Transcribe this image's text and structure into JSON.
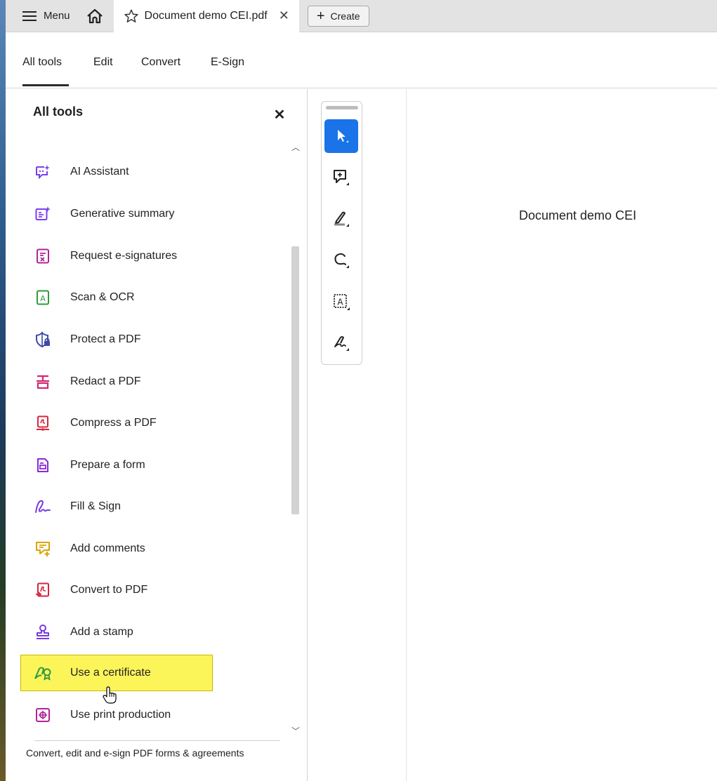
{
  "tabbar": {
    "menu_label": "Menu",
    "doc_tab_title": "Document demo CEI.pdf",
    "create_label": "Create"
  },
  "nav": {
    "items": [
      "All tools",
      "Edit",
      "Convert",
      "E-Sign"
    ],
    "active": "All tools"
  },
  "panel": {
    "title": "All tools",
    "tools": [
      {
        "label": "AI Assistant",
        "icon": "ai-assistant-icon",
        "color": "#7b3ff2"
      },
      {
        "label": "Generative summary",
        "icon": "generative-summary-icon",
        "color": "#7b3ff2"
      },
      {
        "label": "Request e-signatures",
        "icon": "request-esignatures-icon",
        "color": "#b0249a"
      },
      {
        "label": "Scan & OCR",
        "icon": "scan-ocr-icon",
        "color": "#2e9a3e"
      },
      {
        "label": "Protect a PDF",
        "icon": "protect-pdf-icon",
        "color": "#3d4aa8"
      },
      {
        "label": "Redact a PDF",
        "icon": "redact-pdf-icon",
        "color": "#d5286f"
      },
      {
        "label": "Compress a PDF",
        "icon": "compress-pdf-icon",
        "color": "#d7263d"
      },
      {
        "label": "Prepare a form",
        "icon": "prepare-form-icon",
        "color": "#8a2ad8"
      },
      {
        "label": "Fill & Sign",
        "icon": "fill-sign-icon",
        "color": "#7a3ae0"
      },
      {
        "label": "Add comments",
        "icon": "add-comments-icon",
        "color": "#d9a300"
      },
      {
        "label": "Convert to PDF",
        "icon": "convert-to-pdf-icon",
        "color": "#d7263d"
      },
      {
        "label": "Add a stamp",
        "icon": "add-stamp-icon",
        "color": "#7a3ae0"
      },
      {
        "label": "Use a certificate",
        "icon": "certificate-icon",
        "color": "#2e9a3e",
        "highlighted": true
      },
      {
        "label": "Use print production",
        "icon": "print-production-icon",
        "color": "#b0249a"
      }
    ],
    "footer": "Convert, edit and e-sign PDF forms & agreements"
  },
  "toolbar": {
    "buttons": [
      "select-tool-icon",
      "add-comment-icon",
      "highlight-icon",
      "draw-lasso-icon",
      "text-box-icon",
      "sign-icon"
    ],
    "active_color": "#1a73e8"
  },
  "document": {
    "heading": "Document demo CEI"
  }
}
